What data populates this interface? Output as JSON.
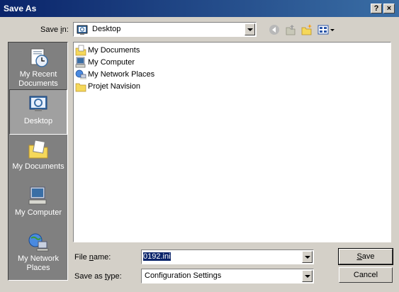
{
  "window": {
    "title": "Save As",
    "help_button": "?",
    "close_button": "×"
  },
  "save_in": {
    "label_pre": "Save ",
    "label_key": "i",
    "label_post": "n:",
    "value": "Desktop"
  },
  "toolbar": {
    "icons": [
      "back-icon",
      "up-folder-icon",
      "new-folder-icon",
      "views-menu-icon"
    ]
  },
  "places": [
    {
      "label_line1": "My Recent",
      "label_line2": "Documents",
      "icon": "recent-documents-icon"
    },
    {
      "label_line1": "Desktop",
      "label_line2": "",
      "icon": "desktop-icon"
    },
    {
      "label_line1": "My Documents",
      "label_line2": "",
      "icon": "my-documents-icon"
    },
    {
      "label_line1": "My Computer",
      "label_line2": "",
      "icon": "my-computer-icon"
    },
    {
      "label_line1": "My Network",
      "label_line2": "Places",
      "icon": "network-places-icon"
    }
  ],
  "files": [
    {
      "name": "My Documents",
      "icon": "documents-folder-icon"
    },
    {
      "name": "My Computer",
      "icon": "computer-icon"
    },
    {
      "name": "My Network Places",
      "icon": "network-icon"
    },
    {
      "name": "Projet Navision",
      "icon": "folder-icon"
    }
  ],
  "file_name": {
    "label_pre": "File ",
    "label_key": "n",
    "label_post": "ame:",
    "value": "0192.ini"
  },
  "save_as_type": {
    "label_pre": "Save as ",
    "label_key": "t",
    "label_post": "ype:",
    "value": "Configuration Settings"
  },
  "buttons": {
    "save_key": "S",
    "save_rest": "ave",
    "cancel": "Cancel"
  }
}
